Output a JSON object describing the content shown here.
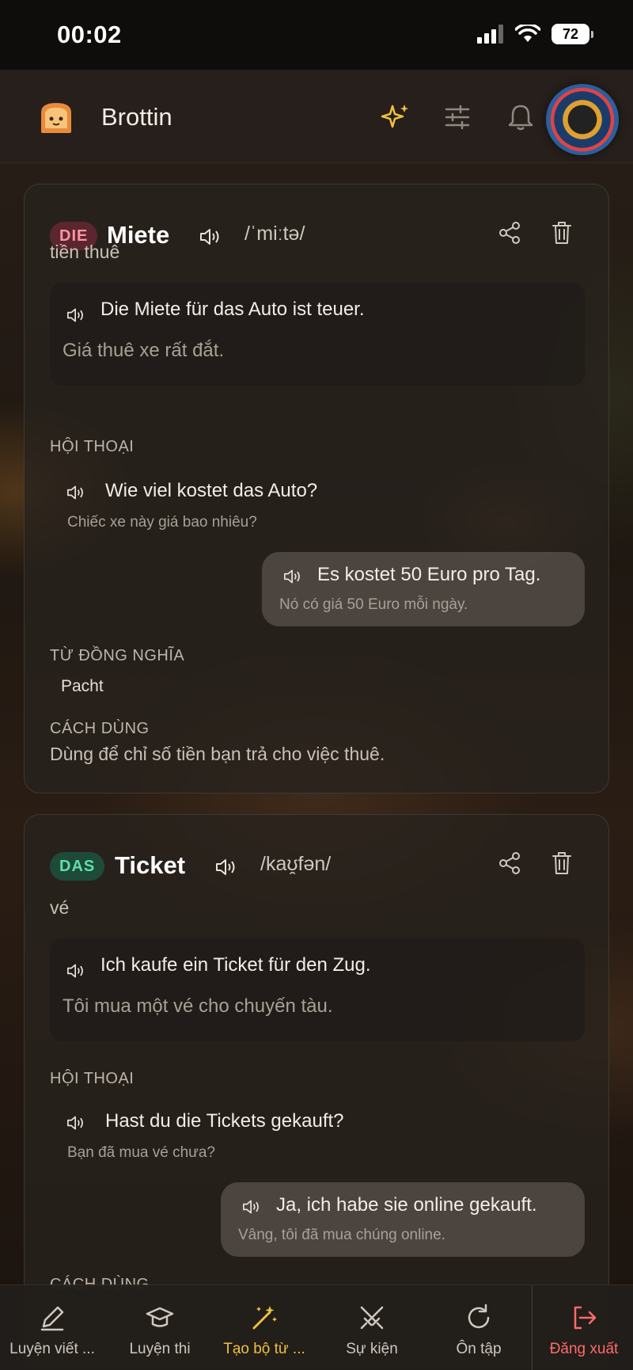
{
  "status_bar": {
    "time": "00:02",
    "battery": "72"
  },
  "header": {
    "title": "Brottin"
  },
  "cards": [
    {
      "article": "DIE",
      "word": "Miete",
      "ipa": "/ˈmiːtə/",
      "meaning": "tiền thuê",
      "example": {
        "de": "Die Miete für das Auto ist teuer.",
        "vi": "Giá thuê xe rất đắt."
      },
      "dialogue_label": "HỘI THOẠI",
      "dialogue": [
        {
          "de": "Wie viel kostet das Auto?",
          "vi": "Chiếc xe này giá bao nhiêu?"
        },
        {
          "de": "Es kostet 50 Euro pro Tag.",
          "vi": "Nó có giá 50 Euro mỗi ngày."
        }
      ],
      "synonyms_label": "TỪ ĐỒNG NGHĨA",
      "synonyms": [
        "Pacht"
      ],
      "usage_label": "CÁCH DÙNG",
      "usage": "Dùng để chỉ số tiền bạn trả cho việc thuê."
    },
    {
      "article": "DAS",
      "word": "Ticket",
      "ipa": "/kaʊ̯fən/",
      "meaning": "vé",
      "example": {
        "de": "Ich kaufe ein Ticket für den Zug.",
        "vi": "Tôi mua một vé cho chuyến tàu."
      },
      "dialogue_label": "HỘI THOẠI",
      "dialogue": [
        {
          "de": "Hast du die Tickets gekauft?",
          "vi": "Bạn đã mua vé chưa?"
        },
        {
          "de": "Ja, ich habe sie online gekauft.",
          "vi": "Vâng, tôi đã mua chúng online."
        }
      ],
      "usage_label": "CÁCH DÙNG"
    }
  ],
  "bottom_nav": [
    {
      "label": "Luyện viết ...",
      "icon": "pencil-icon"
    },
    {
      "label": "Luyện thi",
      "icon": "graduation-cap-icon"
    },
    {
      "label": "Tạo bộ từ ...",
      "icon": "magic-wand-icon",
      "active": true
    },
    {
      "label": "Sự kiện",
      "icon": "crossed-swords-icon"
    },
    {
      "label": "Ôn tập",
      "icon": "refresh-icon"
    },
    {
      "label": "Đăng xuất",
      "icon": "logout-icon"
    }
  ],
  "colors": {
    "accent": "#f0c040",
    "logout": "#ff6a6a",
    "die_badge": "#ff93a4",
    "das_badge": "#5fe0a8"
  }
}
